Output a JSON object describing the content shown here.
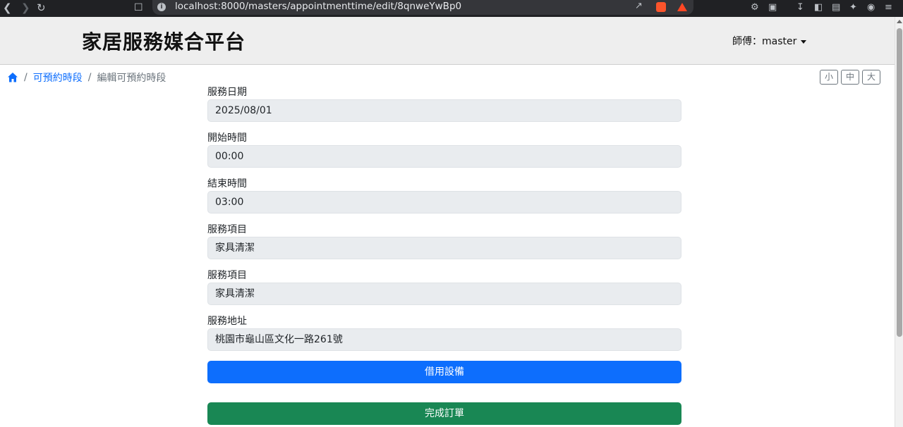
{
  "browser": {
    "url": "localhost:8000/masters/appointmenttime/edit/8qnweYwBp0"
  },
  "header": {
    "brand": "家居服務媒合平台",
    "user_label": "師傅：master"
  },
  "breadcrumb": {
    "level1": "可預約時段",
    "current": "編輯可預約時段",
    "separator": "/"
  },
  "font_size_buttons": {
    "small": "小",
    "medium": "中",
    "large": "大"
  },
  "form": {
    "fields": [
      {
        "label": "服務日期",
        "value": "2025/08/01"
      },
      {
        "label": "開始時間",
        "value": "00:00"
      },
      {
        "label": "結束時間",
        "value": "03:00"
      },
      {
        "label": "服務項目",
        "value": "家具清潔"
      },
      {
        "label": "服務項目",
        "value": "家具清潔"
      },
      {
        "label": "服務地址",
        "value": "桃園市龜山區文化一路261號"
      }
    ],
    "borrow_button": "借用設備",
    "complete_button": "完成訂單"
  },
  "colors": {
    "primary": "#0d6efd",
    "success": "#198754",
    "field_bg": "#e9ecef",
    "header_bg": "#eeeeee"
  }
}
